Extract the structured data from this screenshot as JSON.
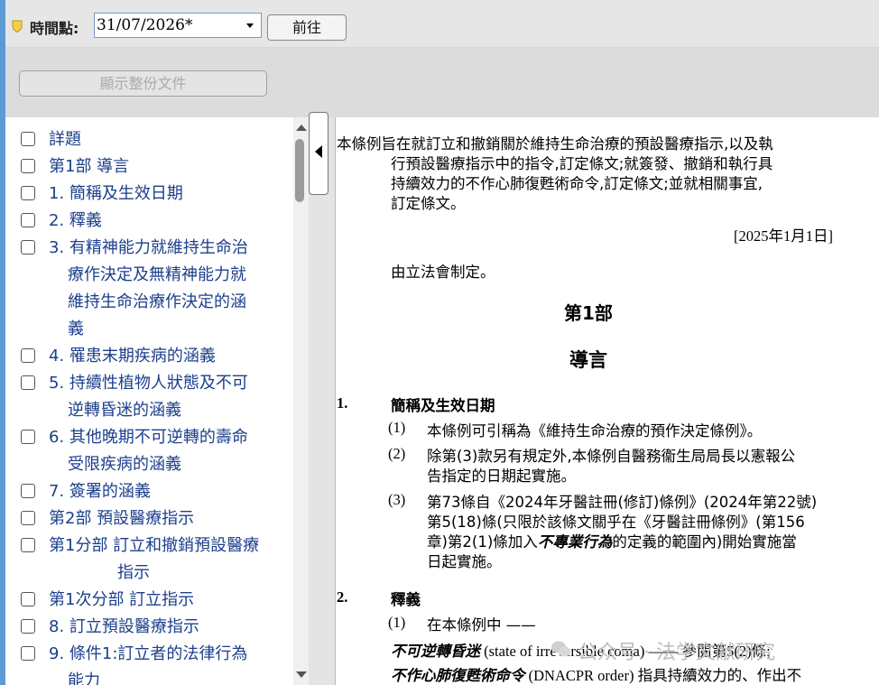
{
  "toolbar": {
    "timepoint_label": "時間點:",
    "date_value": "31/07/2026*",
    "go_label": "前往",
    "show_document_label": "顯示整份文件"
  },
  "toc": {
    "items": [
      {
        "label": "詳題"
      },
      {
        "label": "第1部 導言"
      },
      {
        "label": "1. 簡稱及生效日期"
      },
      {
        "label": "2. 釋義"
      },
      {
        "label": "3. 有精神能力就維持生命治",
        "continuation": [
          "療作決定及無精神能力就",
          "維持生命治療作決定的涵",
          "義"
        ]
      },
      {
        "label": "4. 罹患末期疾病的涵義"
      },
      {
        "label": "5. 持續性植物人狀態及不可",
        "continuation": [
          "逆轉昏迷的涵義"
        ]
      },
      {
        "label": "6. 其他晚期不可逆轉的壽命",
        "continuation": [
          "受限疾病的涵義"
        ]
      },
      {
        "label": "7. 簽署的涵義"
      },
      {
        "label": "第2部 預設醫療指示"
      },
      {
        "label": "第1分部 訂立和撤銷預設醫療",
        "continuation": [
          "指示"
        ]
      },
      {
        "label": "第1次分部 訂立指示"
      },
      {
        "label": "8. 訂立預設醫療指示"
      },
      {
        "label": "9. 條件1:訂立者的法律行為",
        "continuation": [
          "能力"
        ]
      }
    ]
  },
  "document": {
    "long_title": [
      "本條例旨在就訂立和撤銷關於維持生命治療的預設醫療指示,以及執",
      "行預設醫療指示中的指令,訂定條文;就簽發、撤銷和執行具",
      "持續效力的不作心肺復甦術命令,訂定條文;並就相關事宜,",
      "訂定條文。"
    ],
    "date_note": "[2025年1月1日]",
    "enacting_formula": "由立法會制定。",
    "part_number": "第1部",
    "part_title": "導言",
    "s1_number": "1.",
    "s1_heading": "簡稱及生效日期",
    "s1_sub1_num": "(1)",
    "s1_sub1_text": "本條例可引稱為《維持生命治療的預作決定條例》。",
    "s1_sub2_num": "(2)",
    "s1_sub2_lines": [
      "除第(3)款另有規定外,本條例自醫務衞生局局長以憲報公",
      "告指定的日期起實施。"
    ],
    "s1_sub3_num": "(3)",
    "s1_sub3_line1": "第73條自《2024年牙醫註冊(修訂)條例》(2024年第22號)",
    "s1_sub3_line2": "第5(18)條(只限於該條文關乎在《牙醫註冊條例》(第156",
    "s1_sub3_line3_a": "章)第2(1)條加入",
    "s1_sub3_line3_b": "不專業行為",
    "s1_sub3_line3_c": "的定義的範圍內)開始實施當",
    "s1_sub3_line4": "日起實施。",
    "s2_number": "2.",
    "s2_heading": "釋義",
    "s2_sub1_num": "(1)",
    "s2_sub1_text": "在本條例中 ——",
    "def1_term": "不可逆轉昏迷",
    "def1_rest": " (state of irreversible coma) —— 參閱第5(2)條;",
    "def2_term": "不作心肺復甦術命令",
    "def2_rest": " (DNACPR order) 指具持續效力的、作出不"
  },
  "watermark": {
    "text": "公众号 · 法学文献研究"
  },
  "colors": {
    "link": "#1c3f8c",
    "accent": "#5b9bd5",
    "toolbar_bg": "#e6e6e6"
  }
}
